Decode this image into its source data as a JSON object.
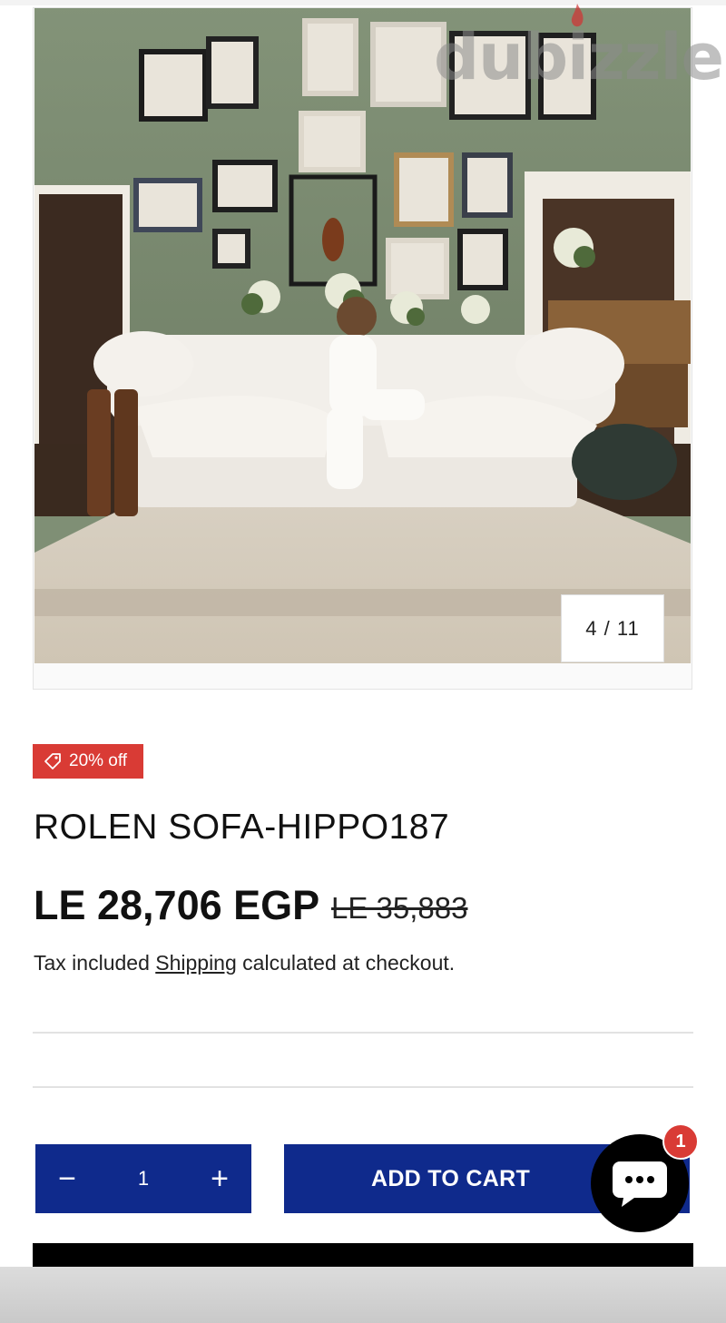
{
  "gallery": {
    "counter": "4 / 11",
    "watermark": "dubizzle"
  },
  "product": {
    "badge": "20% off",
    "title": "ROLEN SOFA-HIPPO187",
    "price": "LE 28,706 EGP",
    "compare_price": "LE 35,883",
    "tax_prefix": "Tax included ",
    "shipping_link": "Shipping",
    "tax_suffix": " calculated at checkout."
  },
  "cart": {
    "quantity": "1",
    "minus": "−",
    "plus": "+",
    "add_label": "ADD TO CART"
  },
  "chat": {
    "badge_count": "1"
  },
  "colors": {
    "accent": "#0f2a8c",
    "badge": "#d93b35"
  }
}
